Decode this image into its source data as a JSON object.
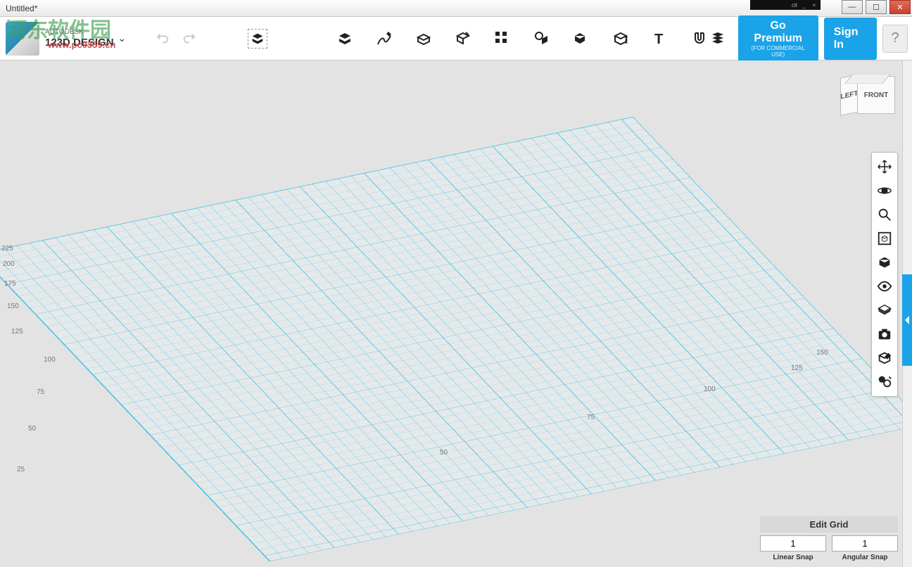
{
  "window": {
    "title": "Untitled*"
  },
  "mini_tab": {
    "label": "cit"
  },
  "brand": {
    "company": "AUTODESK",
    "product": "123D  DESIGN",
    "tm": "®"
  },
  "watermark": {
    "text": "河东软件园",
    "url": "www.pc0359.cn"
  },
  "toolbar": {
    "go_premium": "Go Premium",
    "go_premium_sub": "(FOR COMMERCIAL USE)",
    "sign_in": "Sign In",
    "help": "?",
    "tools": [
      "transform",
      "primitives",
      "sketch",
      "construct",
      "modify",
      "pattern",
      "grouping",
      "combine",
      "measure",
      "text",
      "snap"
    ]
  },
  "viewcube": {
    "front": "FRONT",
    "left": "LEFT",
    "top": ""
  },
  "navtools": [
    "pan",
    "orbit",
    "zoom",
    "fit",
    "home-view",
    "toggle-visibility",
    "grid-display",
    "screenshot",
    "materials-sel",
    "choose-material"
  ],
  "grid_axis_labels": [
    "25",
    "50",
    "75",
    "100",
    "125",
    "150",
    "175",
    "200",
    "225",
    "50",
    "75",
    "100",
    "125",
    "150"
  ],
  "snap": {
    "edit_grid": "Edit Grid",
    "linear_value": "1",
    "angular_value": "1",
    "linear_label": "Linear Snap",
    "angular_label": "Angular Snap"
  }
}
